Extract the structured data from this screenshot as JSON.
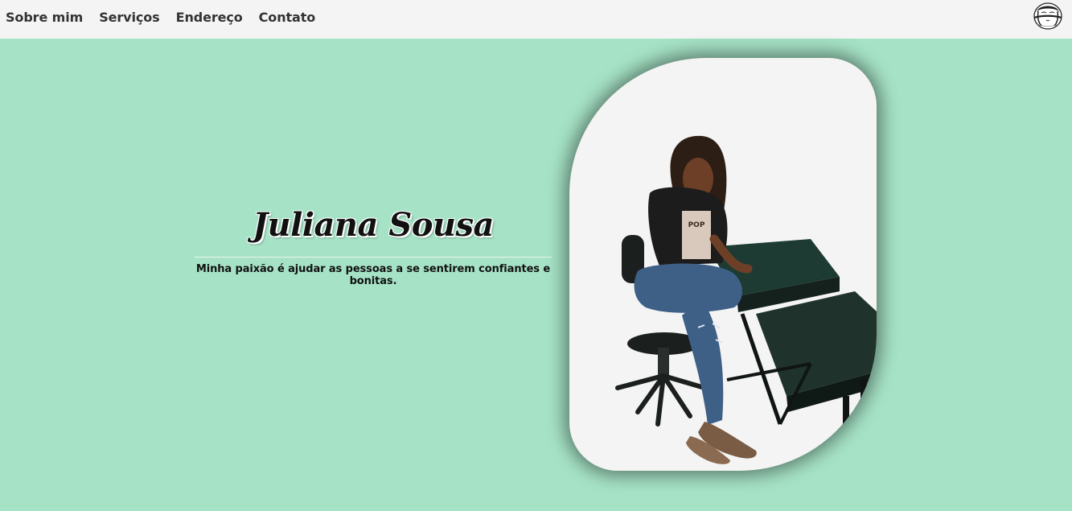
{
  "nav": {
    "items": [
      {
        "label": "Sobre mim"
      },
      {
        "label": "Serviços"
      },
      {
        "label": "Endereço"
      },
      {
        "label": "Contato"
      }
    ],
    "logo_text": "Juliana Sousa"
  },
  "hero": {
    "name": "Juliana Sousa",
    "tagline": "Minha paixão é ajudar as pessoas a se sentirem confiantes e bonitas."
  },
  "colors": {
    "background": "#a6e3c6",
    "navbar": "#f4f4f4",
    "frame": "#f4f4f4"
  }
}
